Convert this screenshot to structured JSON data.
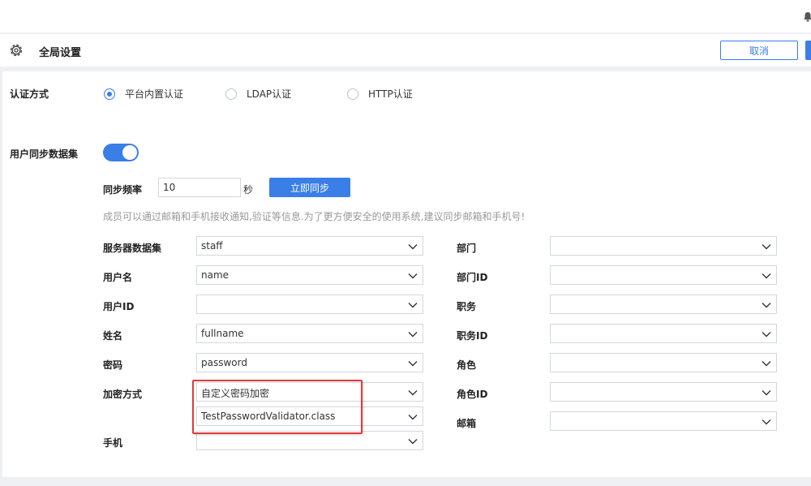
{
  "header": {
    "title": "全局设置",
    "cancel_label": "取消"
  },
  "auth": {
    "label": "认证方式",
    "options": [
      {
        "label": "平台内置认证",
        "checked": true
      },
      {
        "label": "LDAP认证",
        "checked": false
      },
      {
        "label": "HTTP认证",
        "checked": false
      }
    ]
  },
  "sync": {
    "label": "用户同步数据集",
    "enabled": true,
    "frequency_label": "同步频率",
    "frequency_value": "10",
    "frequency_unit": "秒",
    "sync_now_label": "立即同步",
    "hint": "成员可以通过邮箱和手机接收通知,验证等信息.为了更方便安全的使用系统,建议同步邮箱和手机号!"
  },
  "fields_left": [
    {
      "label": "服务器数据集",
      "value": "staff"
    },
    {
      "label": "用户名",
      "value": "name"
    },
    {
      "label": "用户ID",
      "value": ""
    },
    {
      "label": "姓名",
      "value": "fullname"
    },
    {
      "label": "密码",
      "value": "password"
    },
    {
      "label": "加密方式",
      "value": "自定义密码加密"
    },
    {
      "label": "",
      "value": "TestPasswordValidator.class"
    },
    {
      "label": "手机",
      "value": ""
    }
  ],
  "fields_right": [
    {
      "label": "部门",
      "value": ""
    },
    {
      "label": "部门ID",
      "value": ""
    },
    {
      "label": "职务",
      "value": ""
    },
    {
      "label": "职务ID",
      "value": ""
    },
    {
      "label": "角色",
      "value": ""
    },
    {
      "label": "角色ID",
      "value": ""
    },
    {
      "label": "邮箱",
      "value": ""
    }
  ]
}
